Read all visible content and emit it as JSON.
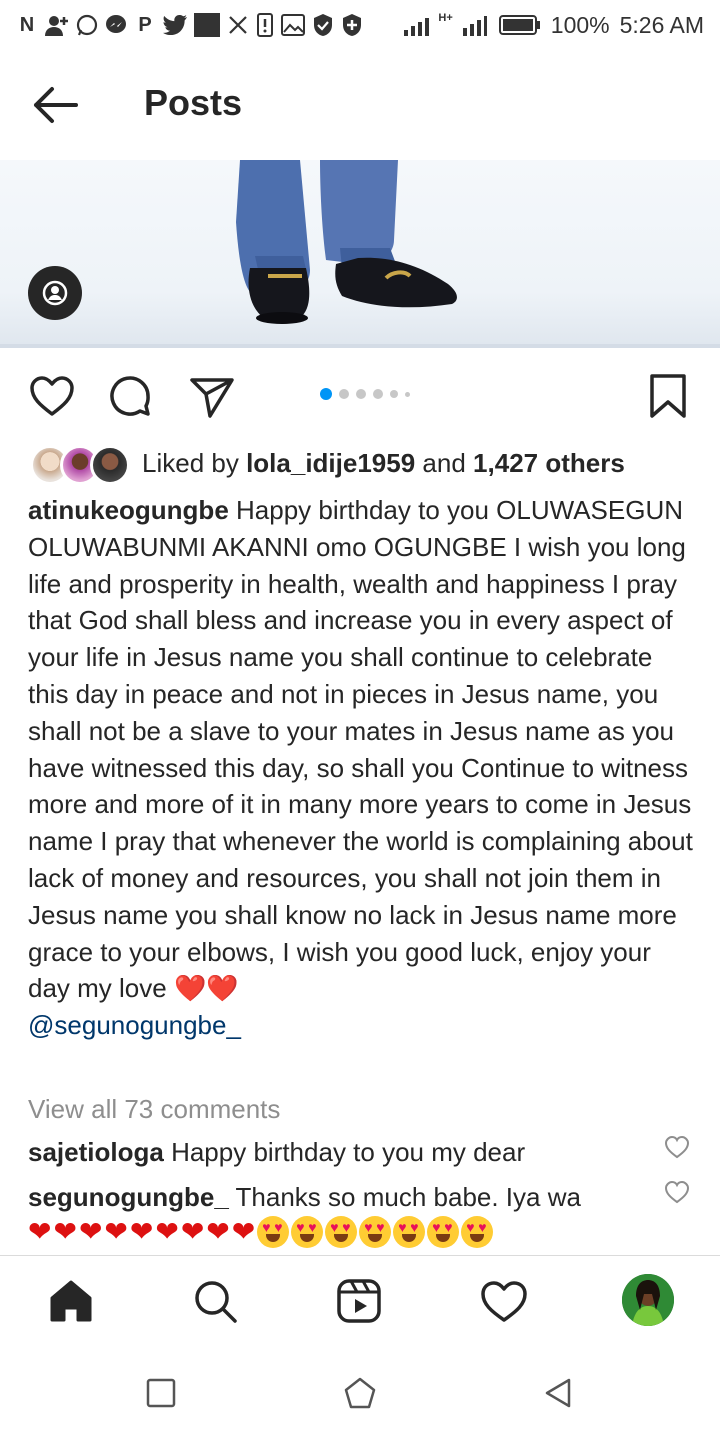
{
  "status_bar": {
    "left_icons": [
      "n-icon",
      "add-person-icon",
      "whatsapp-icon",
      "messenger-icon",
      "p-icon",
      "twitter-icon",
      "image-block-icon",
      "x-icon",
      "notification-icon",
      "gallery-icon",
      "shield-icon",
      "shield-icon"
    ],
    "network": "H+",
    "battery": "100%",
    "time": "5:26 AM"
  },
  "header": {
    "title": "Posts",
    "back_icon": "arrow-left-icon"
  },
  "post": {
    "carousel": {
      "total": 6,
      "active": 0
    },
    "likes": {
      "prefix": "Liked by",
      "user": "lola_idije1959",
      "middle": "and",
      "others": "1,427 others"
    },
    "caption": {
      "username": "atinukeogungbe",
      "text": "Happy birthday to you OLUWASEGUN OLUWABUNMI AKANNI omo OGUNGBE I wish you long life and prosperity in health, wealth and happiness I pray that God shall bless and increase you in every aspect of your life in Jesus name you shall continue to celebrate this day in peace and not in pieces in Jesus name, you shall not be a slave to your mates in Jesus name as you have witnessed this day, so shall you Continue to witness more and more of it in many more years to come in Jesus name I pray that whenever the world is complaining about lack of money and resources, you shall not join them in Jesus name you shall know no lack in Jesus name more grace to your elbows, I wish you good luck, enjoy your day my love",
      "emoji": "❤️❤️",
      "mention": "@segunogungbe_"
    },
    "view_comments": "View all 73 comments",
    "comments": [
      {
        "username": "sajetiologa",
        "text": "Happy birthday to you my dear"
      },
      {
        "username": "segunogungbe_",
        "text": "Thanks so much babe. Iya wa"
      }
    ],
    "reply_emoji": {
      "red_hearts": 9,
      "heart_eyes": 7
    }
  },
  "colors": {
    "text": "#262626",
    "muted": "#8e8e8e",
    "link": "#00376b",
    "carousel_active": "#0095f6",
    "heart": "#d11"
  },
  "bottom_nav": [
    "home-icon",
    "search-icon",
    "reels-icon",
    "heart-icon",
    "profile-avatar"
  ],
  "system_nav": [
    "recents-square-icon",
    "home-pentagon-icon",
    "back-triangle-icon"
  ]
}
